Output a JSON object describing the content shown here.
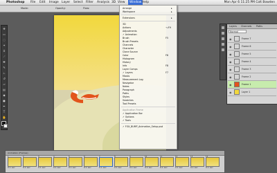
{
  "menubar": {
    "apple": "",
    "app": "Photoshop",
    "items": [
      "File",
      "Edit",
      "Image",
      "Layer",
      "Select",
      "Filter",
      "Analysis",
      "3D",
      "View",
      "Window",
      "Help"
    ],
    "active": "Window",
    "status": "Mon Apr 6  11:25 PM   Colt Bowden"
  },
  "options_bar": {
    "mode_label": "Mode:",
    "opacity_label": "Opacity:",
    "flow_label": "Flow:"
  },
  "window_menu": {
    "items": [
      {
        "label": "Arrange",
        "arrow": "▸"
      },
      {
        "label": "Workspace",
        "arrow": "▸"
      },
      {
        "label": "Extensions",
        "arrow": "▸"
      },
      {
        "label": "3D"
      },
      {
        "label": "Actions",
        "shortcut": "⌥F9"
      },
      {
        "label": "Adjustments"
      },
      {
        "label": "✓ Animation"
      },
      {
        "label": "Brush",
        "shortcut": "F5"
      },
      {
        "label": "Brush Presets"
      },
      {
        "label": "Channels"
      },
      {
        "label": "Character"
      },
      {
        "label": "Clone Source"
      },
      {
        "label": "Color",
        "shortcut": "F6"
      },
      {
        "label": "Histogram"
      },
      {
        "label": "History"
      },
      {
        "label": "Info",
        "shortcut": "F8"
      },
      {
        "label": "Layer Comps"
      },
      {
        "label": "✓ Layers",
        "shortcut": "F7"
      },
      {
        "label": "Masks"
      },
      {
        "label": "Measurement Log"
      },
      {
        "label": "Navigator"
      },
      {
        "label": "Notes"
      },
      {
        "label": "Paragraph"
      },
      {
        "label": "Paths"
      },
      {
        "label": "Styles"
      },
      {
        "label": "Swatches"
      },
      {
        "label": "Tool Presets"
      },
      {
        "label": "Application Frame",
        "disabled": true
      },
      {
        "label": "✓ Application Bar"
      },
      {
        "label": "✓ Options"
      },
      {
        "label": "✓ Tools"
      },
      {
        "label": "✓ FOX_BUMP_Animation_Setup.psd"
      }
    ]
  },
  "layers_panel": {
    "tabs": [
      "Layers",
      "Channels",
      "Paths"
    ],
    "blend_mode": "Normal",
    "layers": [
      {
        "name": "Frame 7",
        "selected": false
      },
      {
        "name": "Frame 6",
        "selected": false
      },
      {
        "name": "Frame 5",
        "selected": false
      },
      {
        "name": "Frame 4",
        "selected": false
      },
      {
        "name": "Frame 3",
        "selected": false
      },
      {
        "name": "Frame 2",
        "selected": false
      },
      {
        "name": "Frame 1",
        "selected": true
      },
      {
        "name": "Layer 1",
        "selected": false
      }
    ]
  },
  "timeline": {
    "title": "Animation (Frames)",
    "frames": [
      {
        "n": "1",
        "delay": "0.1 sec",
        "selected": false
      },
      {
        "n": "2",
        "delay": "0.1 sec",
        "selected": false
      },
      {
        "n": "3",
        "delay": "0.1 sec",
        "selected": false
      },
      {
        "n": "4",
        "delay": "0.1 sec",
        "selected": false
      },
      {
        "n": "5",
        "delay": "0.1 sec",
        "selected": false
      },
      {
        "n": "6",
        "delay": "0.1 sec",
        "selected": false
      },
      {
        "n": "7",
        "delay": "0.1 sec",
        "selected": true
      },
      {
        "n": "8",
        "delay": "0.1 sec",
        "selected": false
      },
      {
        "n": "9",
        "delay": "0.1 sec",
        "selected": false
      },
      {
        "n": "10",
        "delay": "0.1 sec",
        "selected": false
      },
      {
        "n": "11",
        "delay": "0.1 sec",
        "selected": false
      },
      {
        "n": "12",
        "delay": "0.1 sec",
        "selected": false
      },
      {
        "n": "13",
        "delay": "0.1 sec",
        "selected": false
      },
      {
        "n": "14",
        "delay": "0.1 sec",
        "selected": false
      }
    ]
  },
  "colors": {
    "accent": "#3a6fd8",
    "selected_layer": "#c7ecad",
    "fox_orange": "#e2541c",
    "sky_yellow": "#f2d83c"
  },
  "icons": {
    "apple": "apple-icon",
    "eye": "eye-icon",
    "tool": "tool-icon"
  }
}
